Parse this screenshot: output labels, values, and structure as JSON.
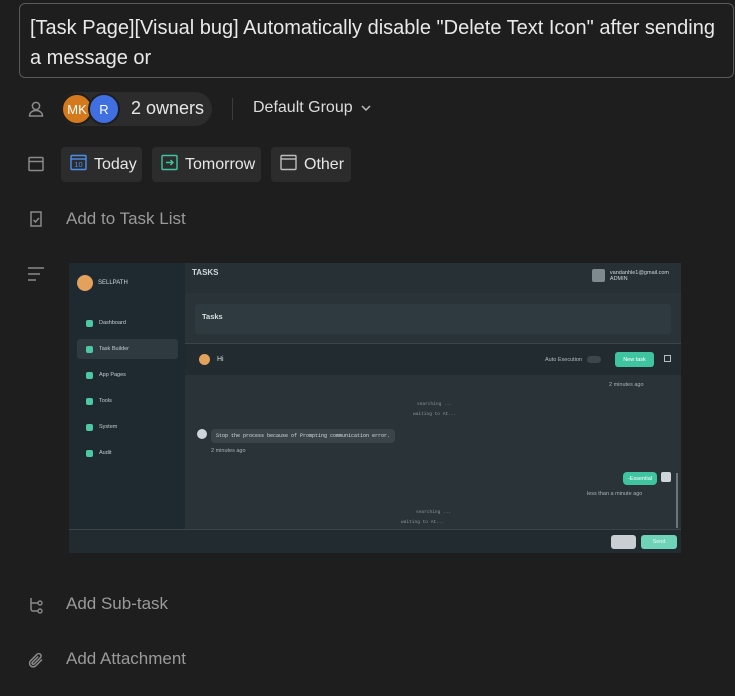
{
  "task": {
    "title": "[Task Page][Visual bug] Automatically disable \"Delete Text Icon\" after sending a message or"
  },
  "owners": {
    "avatars": [
      {
        "initials": "MK",
        "color": "#d4791c"
      },
      {
        "initials": "R",
        "color": "#3f6fe0"
      }
    ],
    "label": "2 owners",
    "group": "Default Group"
  },
  "dates": {
    "today": "Today",
    "tomorrow": "Tomorrow",
    "other": "Other",
    "today_day": "10"
  },
  "actions": {
    "add_to_task_list": "Add to Task List",
    "add_subtask": "Add Sub-task",
    "add_attachment": "Add Attachment"
  },
  "embedded_screenshot": {
    "app_name": "SELLPATH",
    "page_title": "TASKS",
    "user_email": "vandanhle1@gmail.com",
    "user_role": "ADMIN",
    "nav": [
      "Dashboard",
      "Task Builder",
      "App Pages",
      "Tools",
      "System",
      "Audit"
    ],
    "card_title": "Tasks",
    "chat_greeting": "Hi",
    "auto_execution": "Auto Execution",
    "new_task": "New task",
    "log_top_time": "2 minutes ago",
    "log_searching_1": "searching ...",
    "log_waiting_1": "waiting to AI...",
    "error_message": "Stop the process because of Prompting communication error.",
    "error_time": "2 minutes ago",
    "user_bubble": "-Essential",
    "bubble_time": "less than a minute ago",
    "log_searching_2": "searching ...",
    "log_waiting_2": "waiting to AI...",
    "send": "Send"
  },
  "colors": {
    "background": "#1e1e1e",
    "chip": "#2c2c2c",
    "accent_green": "#3ec5a0",
    "accent_blue": "#4a8ff0"
  }
}
